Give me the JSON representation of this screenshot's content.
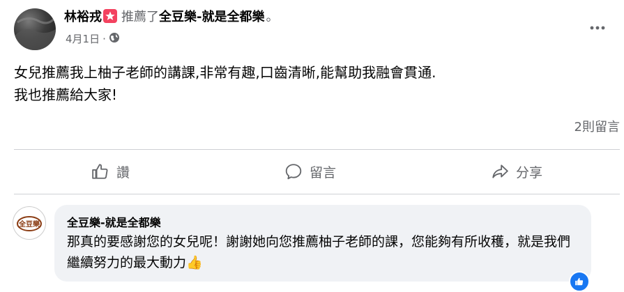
{
  "post": {
    "author": "林裕戎",
    "action": "推薦了",
    "page_name": "全豆樂-就是全都樂",
    "period": "。",
    "date": "4月1日",
    "dot": "·",
    "body_line1": "女兒推薦我上柚子老師的講課,非常有趣,口齒清晰,能幫助我融會貫通.",
    "body_line2": "我也推薦給大家!",
    "comment_count": "2則留言"
  },
  "actions": {
    "like": "讚",
    "comment": "留言",
    "share": "分享"
  },
  "reply": {
    "author": "全豆樂-就是全都樂",
    "avatar_text": "全豆樂",
    "text": "那真的要感謝您的女兒呢！謝謝她向您推薦柚子老師的課，您能夠有所收穫，就是我們繼續努力的最大動力👍"
  },
  "colors": {
    "recommend": "#f3425f",
    "secondary_text": "#65676b",
    "bubble": "#f0f2f5",
    "accent": "#1877f2"
  }
}
